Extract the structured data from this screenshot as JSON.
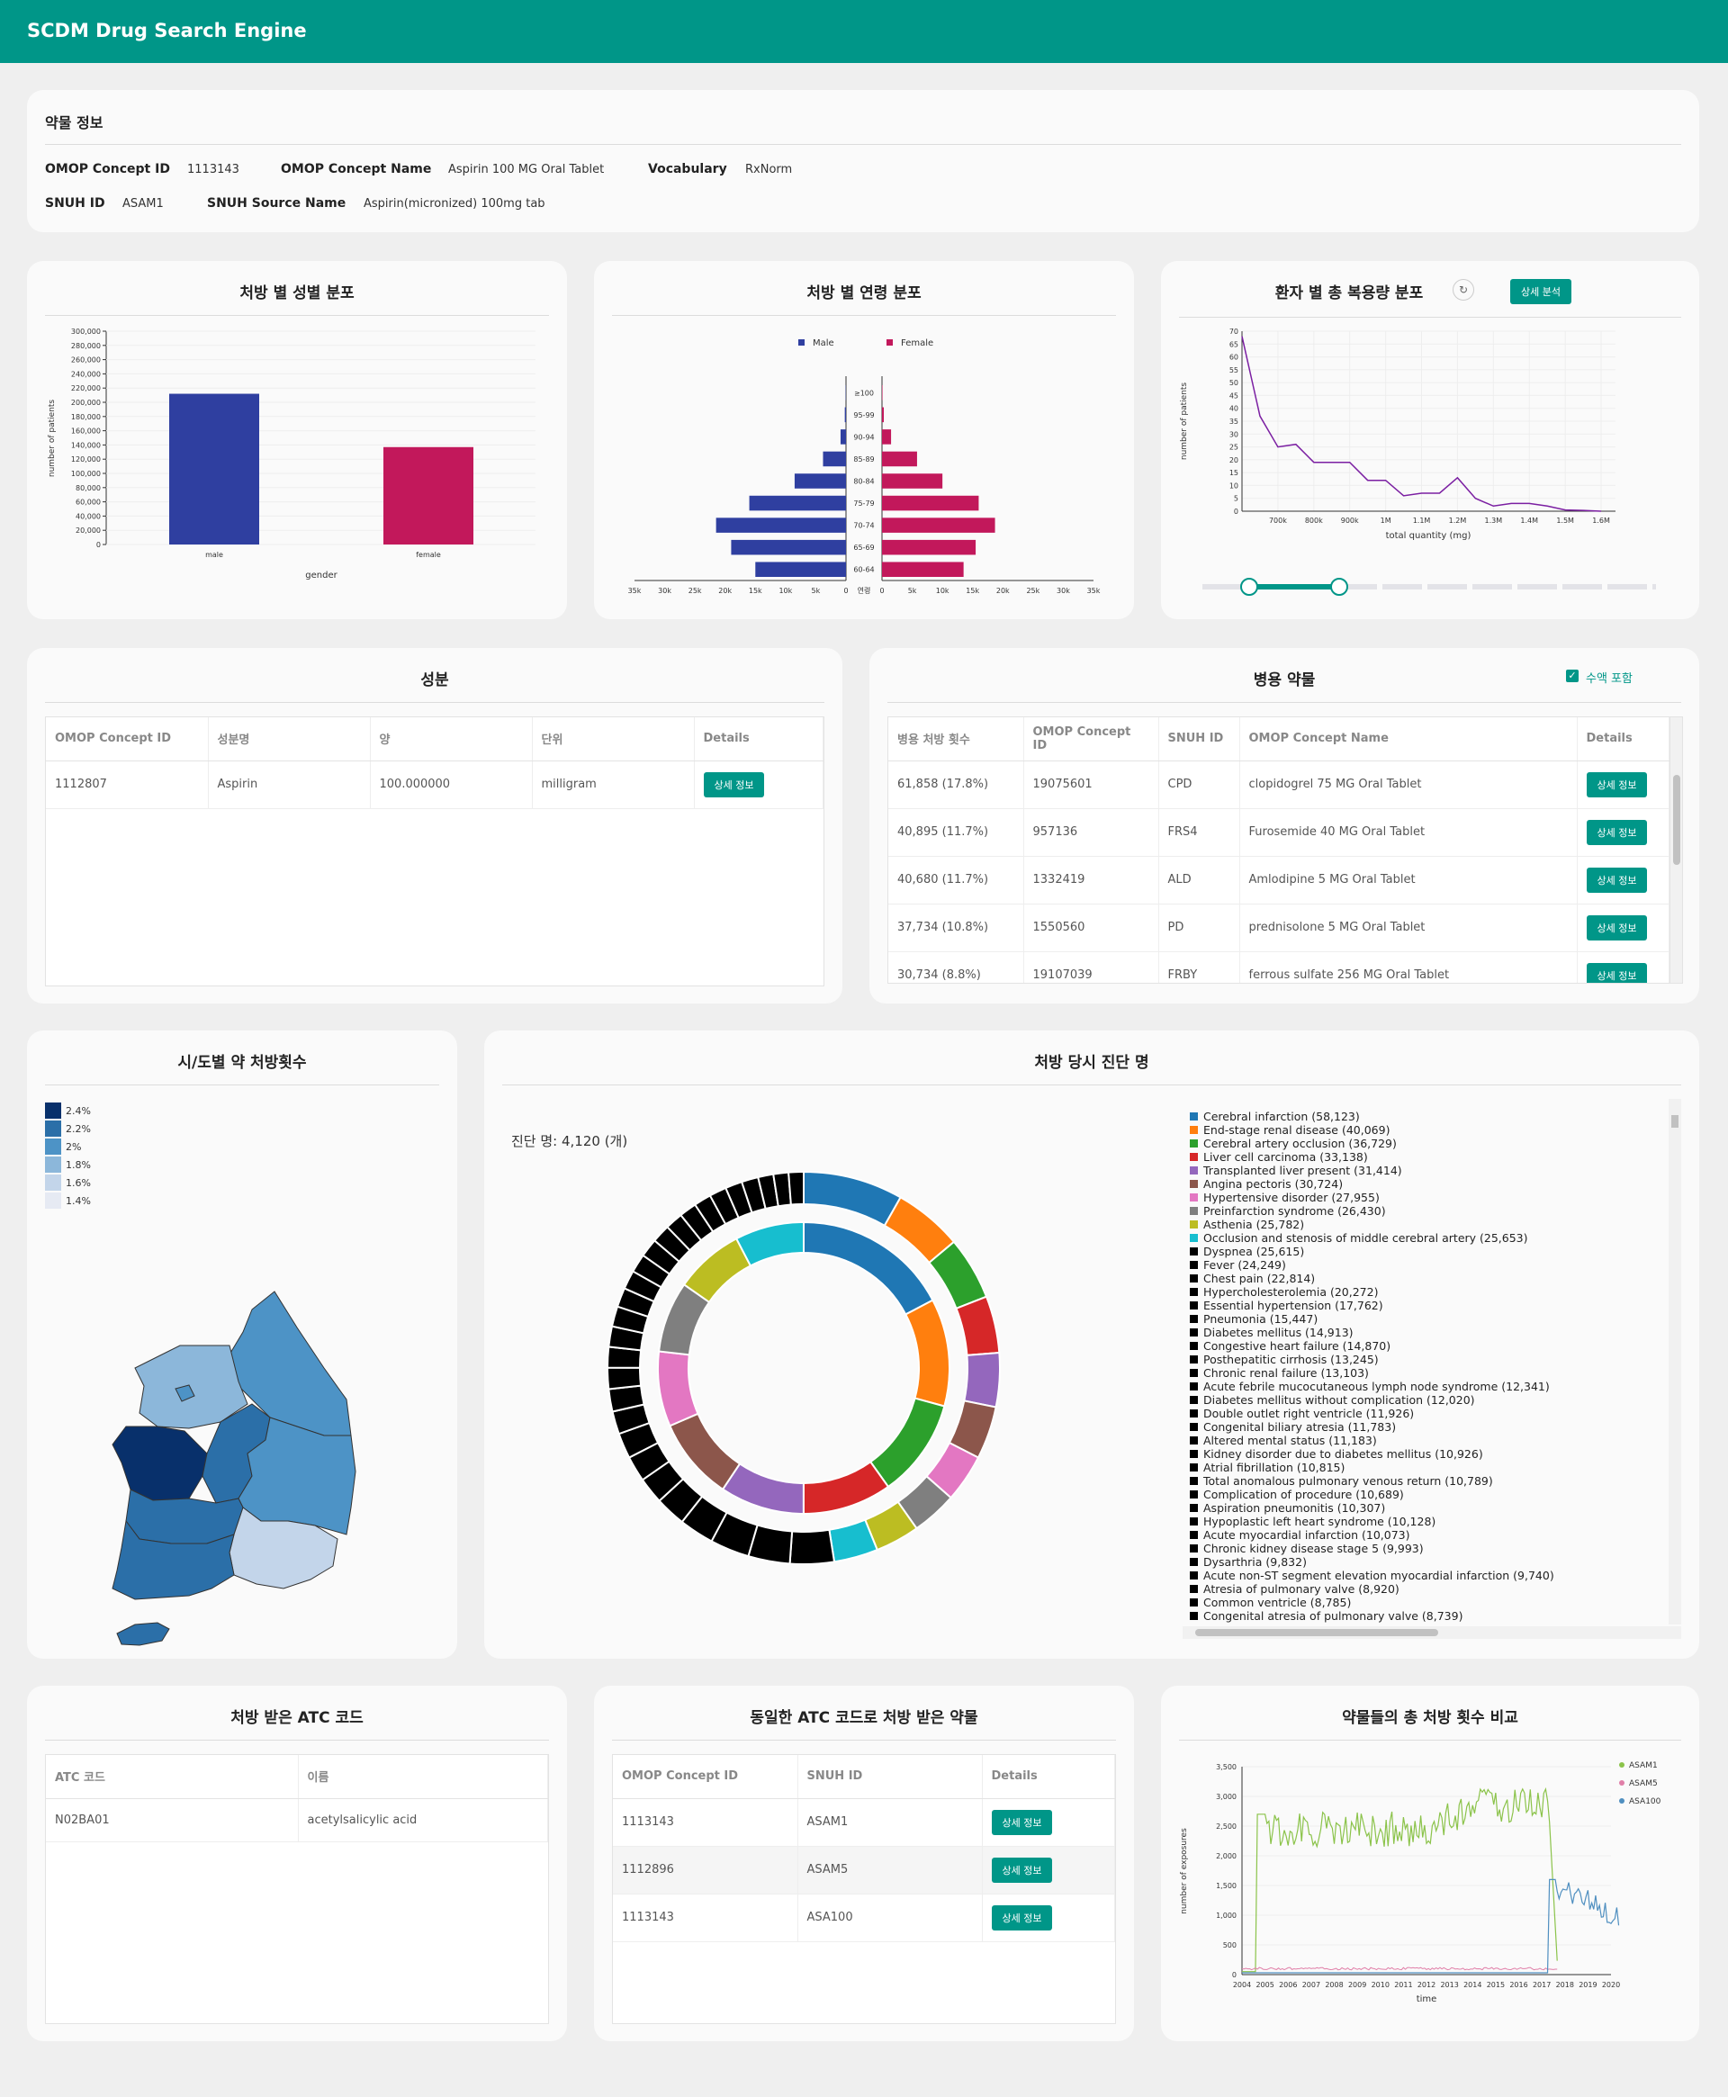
{
  "app": {
    "title": "SCDM Drug Search Engine"
  },
  "drug_info": {
    "title": "약물 정보",
    "concept_id_label": "OMOP Concept ID",
    "concept_id": "1113143",
    "concept_name_label": "OMOP Concept Name",
    "concept_name": "Aspirin 100 MG Oral Tablet",
    "vocabulary_label": "Vocabulary",
    "vocabulary": "RxNorm",
    "snuh_id_label": "SNUH ID",
    "snuh_id": "ASAM1",
    "snuh_source_label": "SNUH Source Name",
    "snuh_source": "Aspirin(micronized) 100mg tab"
  },
  "gender_chart": {
    "title": "처방 별 성별 분포"
  },
  "age_chart": {
    "title": "처방 별 연령 분포"
  },
  "dose_chart": {
    "title": "환자 별 총 복용량 분포",
    "detail_button": "상세 분석"
  },
  "ingredients": {
    "title": "성분",
    "columns": [
      "OMOP Concept ID",
      "성분명",
      "양",
      "단위",
      "Details"
    ],
    "rows": [
      {
        "id": "1112807",
        "name": "Aspirin",
        "amount": "100.000000",
        "unit": "milligram",
        "button": "상세 정보"
      }
    ]
  },
  "concomitant": {
    "title": "병용 약물",
    "checkbox_label": "수액 포함",
    "checkbox_checked": true,
    "columns": [
      "병용 처방 횟수",
      "OMOP Concept ID",
      "SNUH ID",
      "OMOP Concept Name",
      "Details"
    ],
    "rows": [
      {
        "count": "61,858 (17.8%)",
        "id": "19075601",
        "snuh": "CPD",
        "name": "clopidogrel 75 MG Oral Tablet",
        "button": "상세 정보"
      },
      {
        "count": "40,895 (11.7%)",
        "id": "957136",
        "snuh": "FRS4",
        "name": "Furosemide 40 MG Oral Tablet",
        "button": "상세 정보"
      },
      {
        "count": "40,680 (11.7%)",
        "id": "1332419",
        "snuh": "ALD",
        "name": "Amlodipine 5 MG Oral Tablet",
        "button": "상세 정보"
      },
      {
        "count": "37,734 (10.8%)",
        "id": "1550560",
        "snuh": "PD",
        "name": "prednisolone 5 MG Oral Tablet",
        "button": "상세 정보"
      },
      {
        "count": "30,734 (8.8%)",
        "id": "19107039",
        "snuh": "FRBY",
        "name": "ferrous sulfate 256 MG Oral Tablet",
        "button": "상세 정보"
      }
    ]
  },
  "region_map": {
    "title": "시/도별 약 처방횟수",
    "legend": [
      {
        "label": "2.4%",
        "color": "#08306b"
      },
      {
        "label": "2.2%",
        "color": "#2b6fa8"
      },
      {
        "label": "2%",
        "color": "#4d93c6"
      },
      {
        "label": "1.8%",
        "color": "#8cb7da"
      },
      {
        "label": "1.6%",
        "color": "#c3d5ea"
      },
      {
        "label": "1.4%",
        "color": "#e6eaf3"
      }
    ]
  },
  "diagnosis": {
    "title": "처방 당시 진단 명",
    "count_label": "진단 명: 4,120 (개)"
  },
  "atc": {
    "title": "처방 받은 ATC 코드",
    "columns": [
      "ATC 코드",
      "이름"
    ],
    "rows": [
      {
        "code": "N02BA01",
        "name": "acetylsalicylic acid"
      }
    ]
  },
  "same_atc": {
    "title": "동일한 ATC 코드로 처방 받은 약물",
    "columns": [
      "OMOP Concept ID",
      "SNUH ID",
      "Details"
    ],
    "rows": [
      {
        "id": "1113143",
        "snuh": "ASAM1",
        "button": "상세 정보"
      },
      {
        "id": "1112896",
        "snuh": "ASAM5",
        "button": "상세 정보"
      },
      {
        "id": "1113143",
        "snuh": "ASA100",
        "button": "상세 정보"
      }
    ]
  },
  "compare": {
    "title": "약물들의 총 처방 횟수 비교"
  },
  "chart_data": [
    {
      "id": "gender",
      "type": "bar",
      "categories": [
        "male",
        "female"
      ],
      "values": [
        212000,
        137000
      ],
      "xlabel": "gender",
      "ylabel": "number of patients",
      "ylim": [
        0,
        300000
      ],
      "yticks": [
        "0",
        "20,000",
        "40,000",
        "60,000",
        "80,000",
        "100,000",
        "120,000",
        "140,000",
        "160,000",
        "180,000",
        "200,000",
        "220,000",
        "240,000",
        "260,000",
        "280,000",
        "300,000"
      ],
      "colors": [
        "#2f3fa0",
        "#c2185b"
      ]
    },
    {
      "id": "age",
      "type": "bar",
      "orientation": "horizontal-pyramid",
      "categories": [
        "60-64",
        "65-69",
        "70-74",
        "75-79",
        "80-84",
        "85-89",
        "90-94",
        "95-99",
        "≥100"
      ],
      "axis_label": "연령",
      "series": [
        {
          "name": "Male",
          "color": "#2f3fa0",
          "values": [
            15000,
            19000,
            21500,
            16000,
            8500,
            3800,
            900,
            200,
            50
          ]
        },
        {
          "name": "Female",
          "color": "#c2185b",
          "values": [
            13500,
            15500,
            18700,
            16000,
            10000,
            5800,
            1500,
            300,
            80
          ]
        }
      ],
      "xticks": [
        "35k",
        "30k",
        "25k",
        "20k",
        "15k",
        "10k",
        "5k",
        "0",
        "0",
        "5k",
        "10k",
        "15k",
        "20k",
        "25k",
        "30k",
        "35k"
      ]
    },
    {
      "id": "dose",
      "type": "line",
      "xlabel": "total quantity (mg)",
      "ylabel": "number of patients",
      "xticks": [
        "700k",
        "800k",
        "900k",
        "1M",
        "1.1M",
        "1.2M",
        "1.3M",
        "1.4M",
        "1.5M",
        "1.6M"
      ],
      "yticks": [
        "0",
        "5",
        "10",
        "15",
        "20",
        "25",
        "30",
        "35",
        "40",
        "45",
        "50",
        "55",
        "60",
        "65",
        "70"
      ],
      "color": "#7b1fa2",
      "x": [
        600000,
        650000,
        700000,
        750000,
        800000,
        850000,
        900000,
        950000,
        1000000,
        1050000,
        1100000,
        1150000,
        1200000,
        1250000,
        1300000,
        1350000,
        1400000,
        1450000,
        1500000,
        1550000,
        1600000
      ],
      "values": [
        68,
        37,
        25,
        26,
        19,
        19,
        19,
        12,
        12,
        6,
        7,
        7,
        13,
        5,
        2,
        3,
        3,
        2,
        0.5,
        0.3,
        0
      ]
    },
    {
      "id": "diagnosis",
      "type": "pie",
      "style": "double-donut",
      "items": [
        {
          "label": "Cerebral infarction (58,123)",
          "color": "#1f77b4",
          "value": 58123
        },
        {
          "label": "End-stage renal disease (40,069)",
          "color": "#ff7f0e",
          "value": 40069
        },
        {
          "label": "Cerebral artery occlusion (36,729)",
          "color": "#2ca02c",
          "value": 36729
        },
        {
          "label": "Liver cell carcinoma (33,138)",
          "color": "#d62728",
          "value": 33138
        },
        {
          "label": "Transplanted liver present (31,414)",
          "color": "#9467bd",
          "value": 31414
        },
        {
          "label": "Angina pectoris (30,724)",
          "color": "#8c564b",
          "value": 30724
        },
        {
          "label": "Hypertensive disorder (27,955)",
          "color": "#e377c2",
          "value": 27955
        },
        {
          "label": "Preinfarction syndrome (26,430)",
          "color": "#7f7f7f",
          "value": 26430
        },
        {
          "label": "Asthenia (25,782)",
          "color": "#bcbd22",
          "value": 25782
        },
        {
          "label": "Occlusion and stenosis of middle cerebral artery (25,653)",
          "color": "#17becf",
          "value": 25653
        },
        {
          "label": "Dyspnea (25,615)",
          "color": "#000000",
          "value": 25615
        },
        {
          "label": "Fever (24,249)",
          "color": "#000000",
          "value": 24249
        },
        {
          "label": "Chest pain (22,814)",
          "color": "#000000",
          "value": 22814
        },
        {
          "label": "Hypercholesterolemia (20,272)",
          "color": "#000000",
          "value": 20272
        },
        {
          "label": "Essential hypertension (17,762)",
          "color": "#000000",
          "value": 17762
        },
        {
          "label": "Pneumonia (15,447)",
          "color": "#000000",
          "value": 15447
        },
        {
          "label": "Diabetes mellitus (14,913)",
          "color": "#000000",
          "value": 14913
        },
        {
          "label": "Congestive heart failure (14,870)",
          "color": "#000000",
          "value": 14870
        },
        {
          "label": "Posthepatitic cirrhosis (13,245)",
          "color": "#000000",
          "value": 13245
        },
        {
          "label": "Chronic renal failure (13,103)",
          "color": "#000000",
          "value": 13103
        },
        {
          "label": "Acute febrile mucocutaneous lymph node syndrome (12,341)",
          "color": "#000000",
          "value": 12341
        },
        {
          "label": "Diabetes mellitus without complication (12,020)",
          "color": "#000000",
          "value": 12020
        },
        {
          "label": "Double outlet right ventricle (11,926)",
          "color": "#000000",
          "value": 11926
        },
        {
          "label": "Congenital biliary atresia (11,783)",
          "color": "#000000",
          "value": 11783
        },
        {
          "label": "Altered mental status (11,183)",
          "color": "#000000",
          "value": 11183
        },
        {
          "label": "Kidney disorder due to diabetes mellitus (10,926)",
          "color": "#000000",
          "value": 10926
        },
        {
          "label": "Atrial fibrillation (10,815)",
          "color": "#000000",
          "value": 10815
        },
        {
          "label": "Total anomalous pulmonary venous return (10,789)",
          "color": "#000000",
          "value": 10789
        },
        {
          "label": "Complication of procedure (10,689)",
          "color": "#000000",
          "value": 10689
        },
        {
          "label": "Aspiration pneumonitis (10,307)",
          "color": "#000000",
          "value": 10307
        },
        {
          "label": "Hypoplastic left heart syndrome (10,128)",
          "color": "#000000",
          "value": 10128
        },
        {
          "label": "Acute myocardial infarction (10,073)",
          "color": "#000000",
          "value": 10073
        },
        {
          "label": "Chronic kidney disease stage 5 (9,993)",
          "color": "#000000",
          "value": 9993
        },
        {
          "label": "Dysarthria (9,832)",
          "color": "#000000",
          "value": 9832
        },
        {
          "label": "Acute non-ST segment elevation myocardial infarction (9,740)",
          "color": "#000000",
          "value": 9740
        },
        {
          "label": "Atresia of pulmonary valve (8,920)",
          "color": "#000000",
          "value": 8920
        },
        {
          "label": "Common ventricle (8,785)",
          "color": "#000000",
          "value": 8785
        },
        {
          "label": "Congenital atresia of pulmonary valve (8,739)",
          "color": "#000000",
          "value": 8739
        }
      ]
    },
    {
      "id": "compare",
      "type": "line",
      "xlabel": "time",
      "ylabel": "number of exposures",
      "ylim": [
        0,
        3500
      ],
      "yticks": [
        "0",
        "500",
        "1,000",
        "1,500",
        "2,000",
        "2,500",
        "3,000",
        "3,500"
      ],
      "xticks": [
        "2004",
        "2005",
        "2006",
        "2007",
        "2008",
        "2009",
        "2010",
        "2011",
        "2012",
        "2013",
        "2014",
        "2015",
        "2016",
        "2017",
        "2018",
        "2019",
        "2020"
      ],
      "series": [
        {
          "name": "ASAM1",
          "color": "#8bc34a"
        },
        {
          "name": "ASAM5",
          "color": "#e07fa8"
        },
        {
          "name": "ASA100",
          "color": "#4f8fc0"
        }
      ]
    }
  ]
}
